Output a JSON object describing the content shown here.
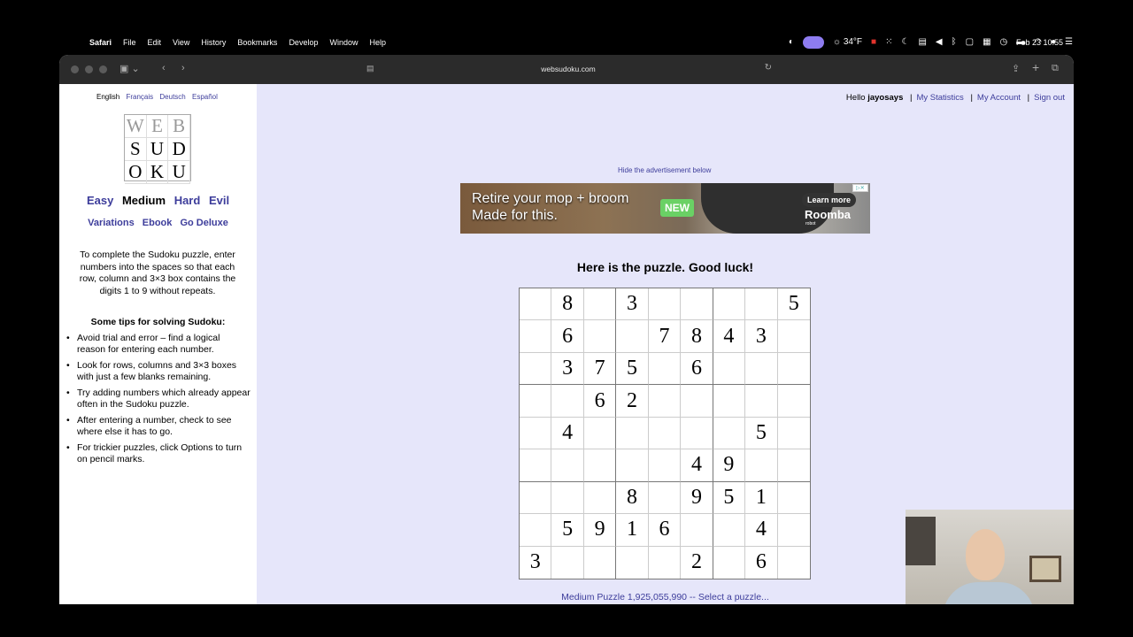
{
  "menubar": {
    "app_name": "Safari",
    "menus": [
      "File",
      "Edit",
      "View",
      "History",
      "Bookmarks",
      "Develop",
      "Window",
      "Help"
    ],
    "weather": "34°F",
    "clock": "Feb 23  10:55"
  },
  "browser": {
    "url": "websudoku.com"
  },
  "sidebar": {
    "languages": [
      "English",
      "Français",
      "Deutsch",
      "Español"
    ],
    "logo_letters": [
      "W",
      "E",
      "B",
      "S",
      "U",
      "D",
      "O",
      "K",
      "U"
    ],
    "levels": [
      "Easy",
      "Medium",
      "Hard",
      "Evil"
    ],
    "links": [
      "Variations",
      "Ebook",
      "Go Deluxe"
    ],
    "intro": "To complete the Sudoku puzzle, enter numbers into the spaces so that each row, column and 3×3 box contains the digits 1 to 9 without repeats.",
    "tips_title": "Some tips for solving Sudoku:",
    "tips": [
      "Avoid trial and error – find a logical reason for entering each number.",
      "Look for rows, columns and 3×3 boxes with just a few blanks remaining.",
      "Try adding numbers which already appear often in the Sudoku puzzle.",
      "After entering a number, check to see where else it has to go.",
      "For trickier puzzles, click Options to turn on pencil marks."
    ]
  },
  "account": {
    "hello": "Hello",
    "username": "jayosays",
    "statistics": "My Statistics",
    "my_account": "My Account",
    "sign_out": "Sign out"
  },
  "ad": {
    "hide_link": "Hide the advertisement below",
    "headline_1": "Retire your mop + broom",
    "headline_2": "Made for this.",
    "badge": "NEW",
    "cta": "Learn more",
    "brand": "Roomba",
    "brand_sub": "robot"
  },
  "puzzle": {
    "title": "Here is the puzzle. Good luck!",
    "footer": "Medium Puzzle 1,925,055,990 -- Select a puzzle...",
    "grid": [
      [
        "",
        "8",
        "",
        "3",
        "",
        "",
        "",
        "",
        "5"
      ],
      [
        "",
        "6",
        "",
        "",
        "7",
        "8",
        "4",
        "3",
        ""
      ],
      [
        "",
        "3",
        "7",
        "5",
        "",
        "6",
        "",
        "",
        ""
      ],
      [
        "",
        "",
        "6",
        "2",
        "",
        "",
        "",
        "",
        ""
      ],
      [
        "",
        "4",
        "",
        "",
        "",
        "",
        "",
        "5",
        ""
      ],
      [
        "",
        "",
        "",
        "",
        "",
        "4",
        "9",
        "",
        ""
      ],
      [
        "",
        "",
        "",
        "8",
        "",
        "9",
        "5",
        "1",
        ""
      ],
      [
        "",
        "5",
        "9",
        "1",
        "6",
        "",
        "",
        "4",
        ""
      ],
      [
        "3",
        "",
        "",
        "",
        "",
        "2",
        "",
        "6",
        ""
      ]
    ]
  }
}
